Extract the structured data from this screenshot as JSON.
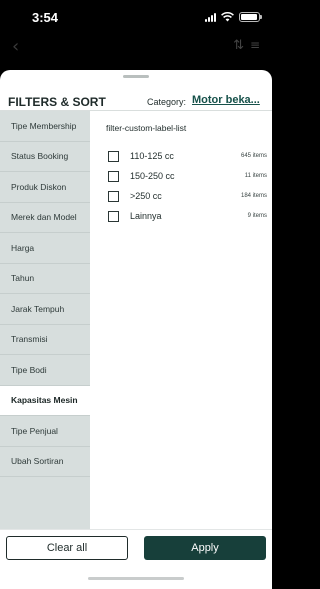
{
  "status_bar": {
    "time": "3:54"
  },
  "nav": {
    "back_icon": "chevron-left-icon",
    "sort_icon": "sort-arrows-icon",
    "menu_icon": "list-icon"
  },
  "sheet": {
    "title": "FILTERS & SORT",
    "category_label": "Category:",
    "category_value": "Motor beka..."
  },
  "sidebar": {
    "items": [
      {
        "label": "Tipe Membership"
      },
      {
        "label": "Status Booking"
      },
      {
        "label": "Produk Diskon"
      },
      {
        "label": "Merek dan Model"
      },
      {
        "label": "Harga"
      },
      {
        "label": "Tahun"
      },
      {
        "label": "Jarak Tempuh"
      },
      {
        "label": "Transmisi"
      },
      {
        "label": "Tipe Bodi"
      },
      {
        "label": "Kapasitas Mesin"
      },
      {
        "label": "Tipe Penjual"
      },
      {
        "label": "Ubah Sortiran"
      }
    ],
    "active": "Kapasitas Mesin"
  },
  "content": {
    "list_label": "filter-custom-label-list",
    "options": [
      {
        "label": "110-125 cc",
        "count": "645 items"
      },
      {
        "label": "150-250 cc",
        "count": "11 items"
      },
      {
        "label": ">250 cc",
        "count": "184 items"
      },
      {
        "label": "Lainnya",
        "count": "9 items"
      }
    ]
  },
  "footer": {
    "clear_label": "Clear all",
    "apply_label": "Apply"
  },
  "colors": {
    "accent": "#173f3a",
    "sidebar_bg": "#d7dedd",
    "category_link": "#16514a"
  }
}
